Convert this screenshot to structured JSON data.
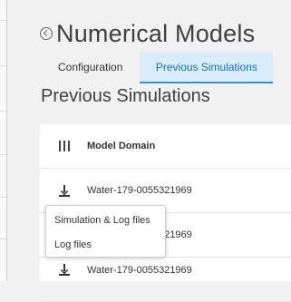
{
  "page": {
    "title": "Numerical Models",
    "back_icon": "back-arrow-circle-icon"
  },
  "tabs": [
    {
      "label": "Configuration",
      "active": false
    },
    {
      "label": "Previous Simulations",
      "active": true
    }
  ],
  "section": {
    "title": "Previous Simulations"
  },
  "table": {
    "columns_icon": "columns-icon",
    "header": "Model Domain",
    "rows": [
      {
        "icon": "download-icon",
        "model_domain": "Water-179-0055321969"
      },
      {
        "icon": "download-icon",
        "model_domain": "Water-179-0055321969"
      },
      {
        "icon": "download-icon",
        "model_domain": "Water-179-0055321969"
      }
    ]
  },
  "download_menu": {
    "items": [
      "Simulation & Log files",
      "Log files"
    ]
  },
  "colors": {
    "accent": "#1a6fb5",
    "active_tab_bg": "#d9ecf9",
    "active_tab_border": "#3d8fd2",
    "panel_bg": "#f1f1f1"
  }
}
